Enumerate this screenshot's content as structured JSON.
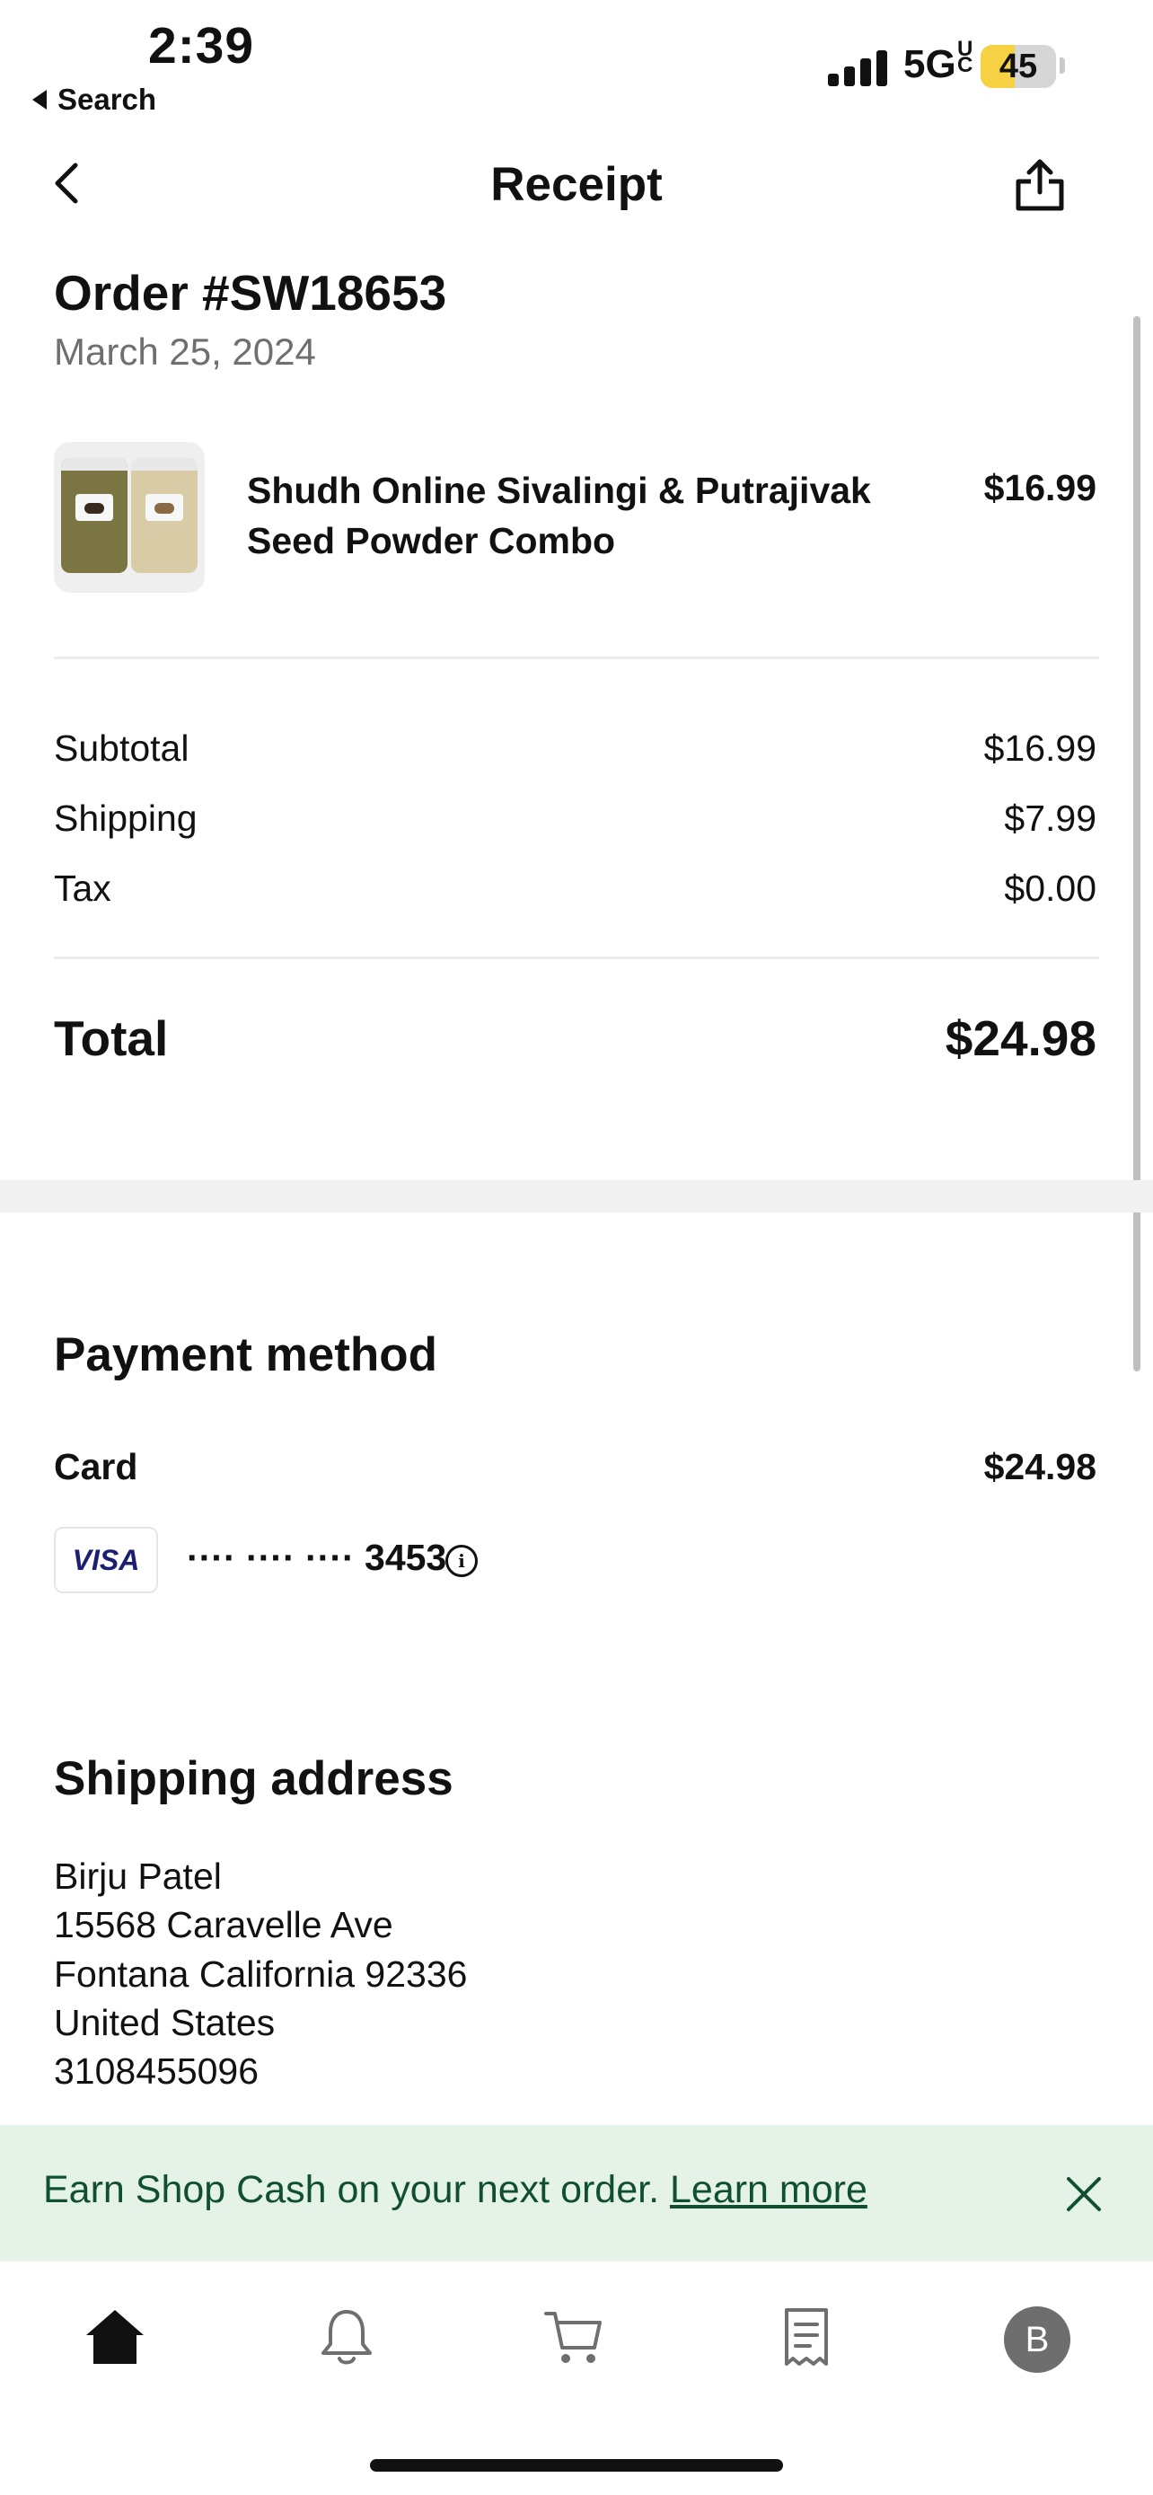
{
  "status_bar": {
    "time": "2:39",
    "back_app": "Search",
    "network": "5GUC",
    "battery_level": "45",
    "battery_fraction": 0.45
  },
  "header": {
    "title": "Receipt",
    "back_icon": "chevron-left-icon",
    "share_icon": "share-icon"
  },
  "order": {
    "title": "Order #SW18653",
    "date": "March 25, 2024",
    "item": {
      "name": "Shudh Online Sivalingi & Putrajivak Seed Powder Combo",
      "price": "$16.99"
    }
  },
  "summary": {
    "rows": [
      {
        "label": "Subtotal",
        "value": "$16.99"
      },
      {
        "label": "Shipping",
        "value": "$7.99"
      },
      {
        "label": "Tax",
        "value": "$0.00"
      }
    ],
    "total_label": "Total",
    "total_value": "$24.98"
  },
  "payment": {
    "title": "Payment method",
    "card_label": "Card",
    "card_amount": "$24.98",
    "card_brand": "VISA",
    "card_number": "···· ···· ···· 3453"
  },
  "shipping": {
    "title": "Shipping address",
    "lines": [
      "Birju Patel",
      "15568 Caravelle Ave",
      "Fontana California 92336",
      "United States",
      "3108455096"
    ]
  },
  "banner": {
    "text": "Earn Shop Cash on your next order.",
    "link": "Learn more"
  },
  "tabbar": {
    "icons": [
      "home-icon",
      "bell-icon",
      "cart-icon",
      "receipt-icon"
    ],
    "avatar_initial": "B"
  },
  "colors": {
    "banner_bg": "#e4f2e8",
    "banner_text": "#114f31",
    "battery_fill": "#f5d143",
    "visa_blue": "#1a1f71"
  }
}
